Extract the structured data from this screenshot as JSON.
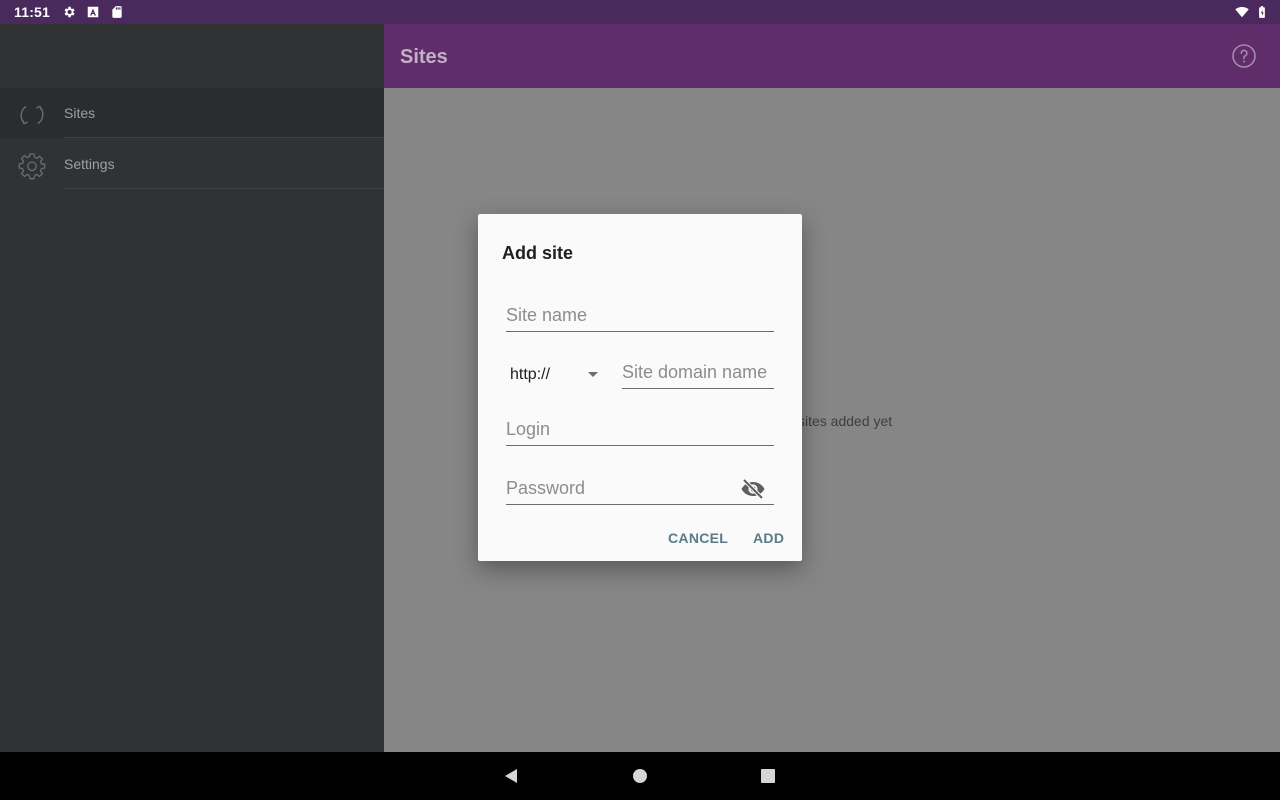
{
  "status_bar": {
    "time": "11:51",
    "left_icons": [
      "gear-icon",
      "a-icon",
      "sd-card-icon"
    ],
    "right_icons": [
      "wifi-icon",
      "battery-icon"
    ]
  },
  "app_bar": {
    "title": "Sites",
    "help_icon": "help-circle-icon"
  },
  "drawer": {
    "items": [
      {
        "label": "Sites",
        "icon": "sync-icon",
        "active": true
      },
      {
        "label": "Settings",
        "icon": "gear-icon",
        "active": false
      }
    ]
  },
  "content": {
    "empty_text": "sites added yet"
  },
  "dialog": {
    "title": "Add site",
    "site_name_placeholder": "Site name",
    "scheme_value": "http://",
    "domain_placeholder": "Site domain name",
    "login_placeholder": "Login",
    "password_placeholder": "Password",
    "cancel_label": "CANCEL",
    "add_label": "ADD"
  },
  "nav_bar": {
    "buttons": [
      "back-icon",
      "home-icon",
      "recents-icon"
    ]
  },
  "colors": {
    "status_bar": "#4a2a5c",
    "app_bar": "#5f2d6a",
    "drawer": "#303234",
    "scrim_content": "#868686",
    "dialog_button": "#5c7a8a"
  }
}
